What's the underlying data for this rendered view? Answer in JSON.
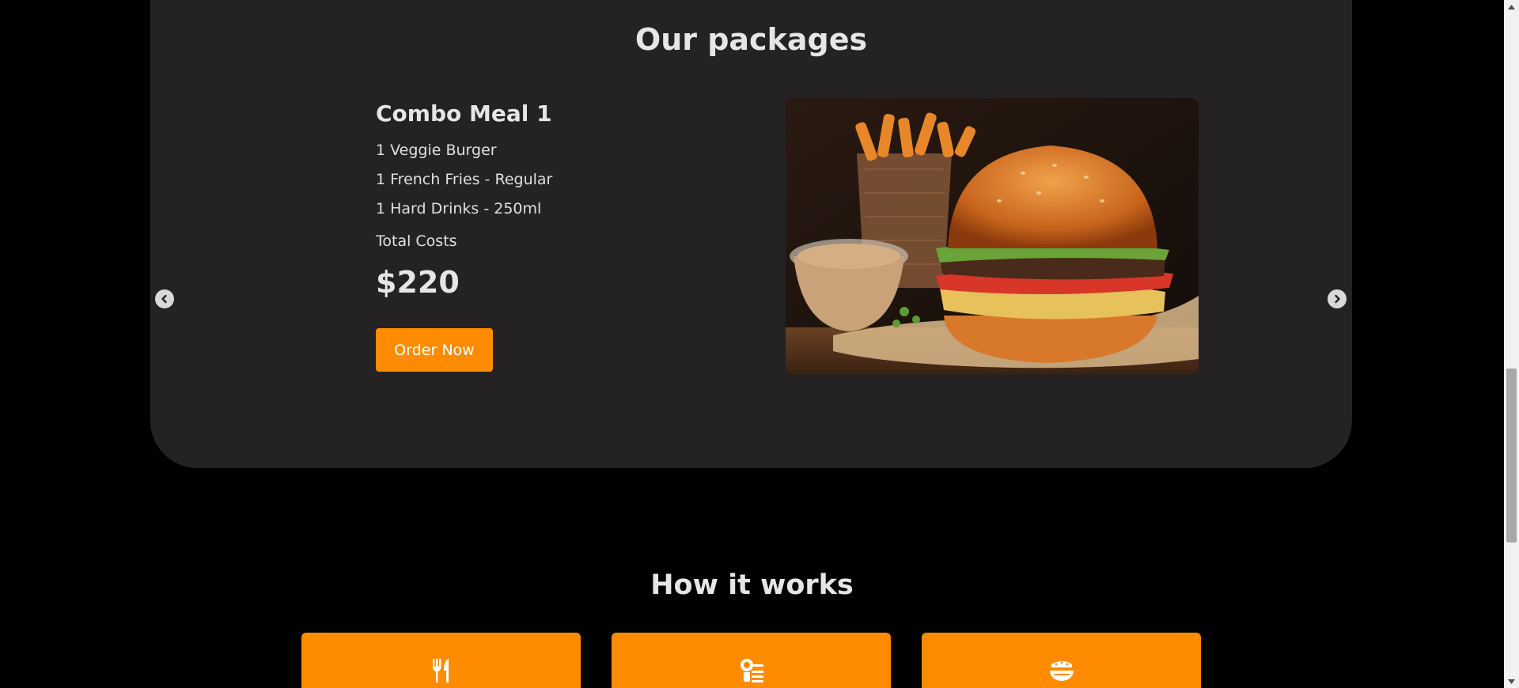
{
  "packages": {
    "title": "Our packages",
    "current": {
      "name": "Combo Meal 1",
      "items": [
        "1 Veggie Burger",
        "1 French Fries - Regular",
        "1 Hard Drinks - 250ml"
      ],
      "total_label": "Total Costs",
      "price": "$220",
      "order_label": "Order Now",
      "image_icon": "burger-fries-photo"
    },
    "prev_icon": "chevron-left-icon",
    "next_icon": "chevron-right-icon"
  },
  "how_it_works": {
    "title": "How it works",
    "steps": [
      {
        "icon": "utensils-icon"
      },
      {
        "icon": "order-icon"
      },
      {
        "icon": "food-platter-icon"
      }
    ]
  },
  "colors": {
    "accent": "#ff8c00",
    "card_bg": "#242223",
    "page_bg": "#000000",
    "text": "#e6e6e6"
  }
}
